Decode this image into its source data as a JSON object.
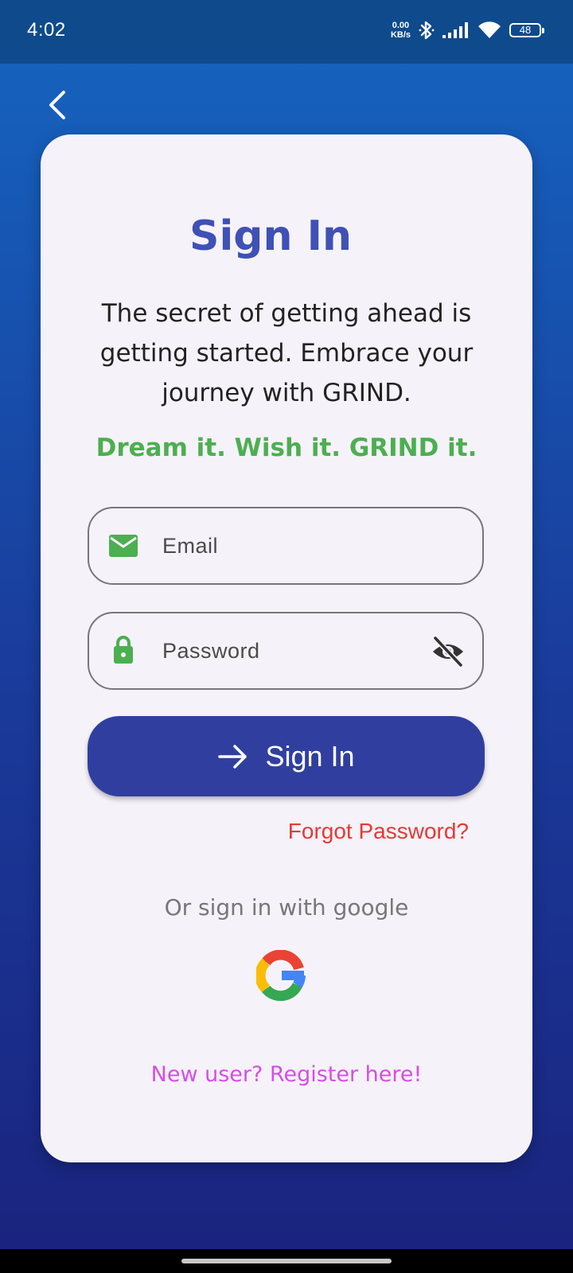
{
  "status_bar": {
    "time": "4:02",
    "net_speed_value": "0.00",
    "net_speed_unit": "KB/s",
    "battery": "48",
    "icons": [
      "bluetooth-icon",
      "signal-icon",
      "wifi-icon",
      "battery-icon"
    ]
  },
  "header": {
    "back_icon": "chevron-left-icon"
  },
  "card": {
    "title": "Sign In",
    "subtitle": "The secret of getting ahead is getting started. Embrace your journey with GRIND.",
    "motto": "Dream it. Wish it. GRIND it."
  },
  "form": {
    "email": {
      "placeholder": "Email",
      "value": "",
      "icon": "mail-icon"
    },
    "password": {
      "placeholder": "Password",
      "value": "",
      "icon": "lock-icon",
      "toggle_icon": "visibility-off-icon"
    },
    "submit_label": "Sign In",
    "submit_icon": "arrow-right-icon",
    "forgot_label": "Forgot Password?"
  },
  "social": {
    "caption": "Or sign in with google",
    "google_icon": "google-icon"
  },
  "register_label": "New user? Register here!",
  "colors": {
    "primary": "#3f51b5",
    "button": "#303f9f",
    "accent_green": "#4caf50",
    "forgot_red": "#e53935",
    "register_magenta": "#d54ee6",
    "card_bg": "#f6f2f9"
  }
}
